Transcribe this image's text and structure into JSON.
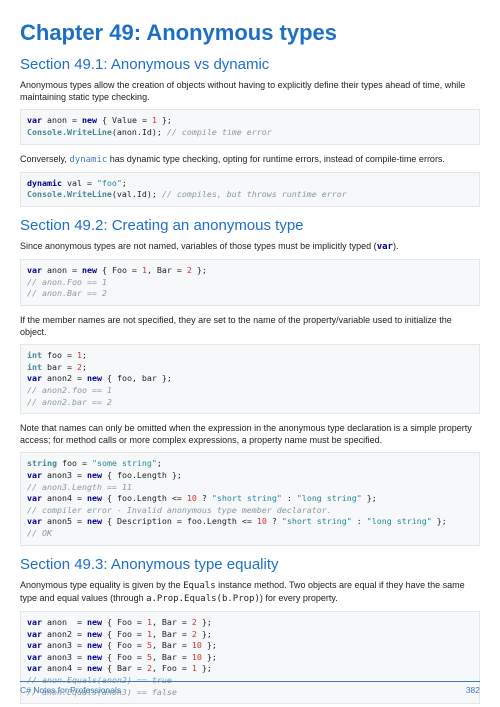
{
  "chapter": {
    "heading": "Chapter 49: Anonymous types"
  },
  "s1": {
    "heading": "Section 49.1: Anonymous vs dynamic",
    "p1": "Anonymous types allow the creation of objects without having to explicitly define their types ahead of time, while maintaining static type checking.",
    "code1": {
      "kw": "var",
      "v": "anon",
      "eq": " = ",
      "nw": "new",
      "b1": " { Value = ",
      "n": "1",
      "b2": " };",
      "l2a": "Console.WriteLine",
      "l2b": "(anon.Id); ",
      "c": "// compile time error"
    },
    "p2a": "Conversely, ",
    "p2b": "dynamic",
    "p2c": " has dynamic type checking, opting for runtime errors, instead of compile-time errors.",
    "code2": {
      "kw": "dynamic",
      "v": " val = ",
      "s": "\"foo\"",
      "e": ";",
      "l2a": "Console.WriteLine",
      "l2b": "(val.Id); ",
      "c": "// compiles, but throws runtime error"
    }
  },
  "s2": {
    "heading": "Section 49.2: Creating an anonymous type",
    "p1a": "Since anonymous types are not named, variables of those types must be implicitly typed (",
    "p1b": "var",
    "p1c": ").",
    "code1": {
      "kw": "var",
      "sp": " anon = ",
      "nw": "new",
      "b": " { Foo = ",
      "n1": "1",
      "m": ", Bar = ",
      "n2": "2",
      "e": " };",
      "c1": "// anon.Foo == 1",
      "c2": "// anon.Bar == 2"
    },
    "p2": "If the member names are not specified, they are set to the name of the property/variable used to initialize the object.",
    "code2": {
      "ty": "int",
      "l1": " foo = ",
      "n1": "1",
      "e1": ";",
      "l2": " bar = ",
      "n2": "2",
      "e2": ";",
      "kw": "var",
      "l3a": " anon2 = ",
      "nw": "new",
      "l3b": " { foo, bar };",
      "c1": "// anon2.foo == 1",
      "c2": "// anon2.bar == 2"
    },
    "p3": "Note that names can only be omitted when the expression in the anonymous type declaration is a simple property access; for method calls or more complex expressions, a property name must be specified.",
    "code3": {
      "ty": "string",
      "l1a": " foo = ",
      "s1": "\"some string\"",
      "e1": ";",
      "kw": "var",
      "l2a": " anon3 = ",
      "nw": "new",
      "l2b": " { foo.Length };",
      "c1": "// anon3.Length == 11",
      "l3a": " anon4 = ",
      "l3b": " { foo.Length <= ",
      "n": "10",
      "l3c": " ? ",
      "s2": "\"short string\"",
      "l3d": " : ",
      "s3": "\"long string\"",
      "l3e": " };",
      "c2": "// compiler error - Invalid anonymous type member declarator.",
      "l4a": " anon5 = ",
      "l4b": " { Description = foo.Length <= ",
      "l4c": " ? ",
      "l4d": " : ",
      "l4e": " };",
      "c3": "// OK"
    }
  },
  "s3": {
    "heading": "Section 49.3: Anonymous type equality",
    "p1a": "Anonymous type equality is given by the ",
    "p1b": "Equals",
    "p1c": " instance method. Two objects are equal if they have the same type and equal values (through ",
    "p1d": "a.Prop.Equals(b.Prop)",
    "p1e": ") for every property.",
    "code1": {
      "kw": "var",
      "nw": "new",
      "l1": " anon  = ",
      " b1": " { Foo = ",
      "n1": "1",
      "m": ", Bar = ",
      "n2": "2",
      "e": " };",
      "l2": " anon2 = ",
      "l3": " anon3 = ",
      "n5": "5",
      "n10": "10",
      "l4": " anon3 = ",
      "l5": " anon4 = ",
      "b5": " { Bar = ",
      "m5": ", Foo = ",
      "c1": "// anon.Equals(anon2) == true",
      "c2": "// anon.Equals(anon3) == false"
    }
  },
  "footer": {
    "left": "C# Notes for Professionals",
    "right": "382"
  }
}
